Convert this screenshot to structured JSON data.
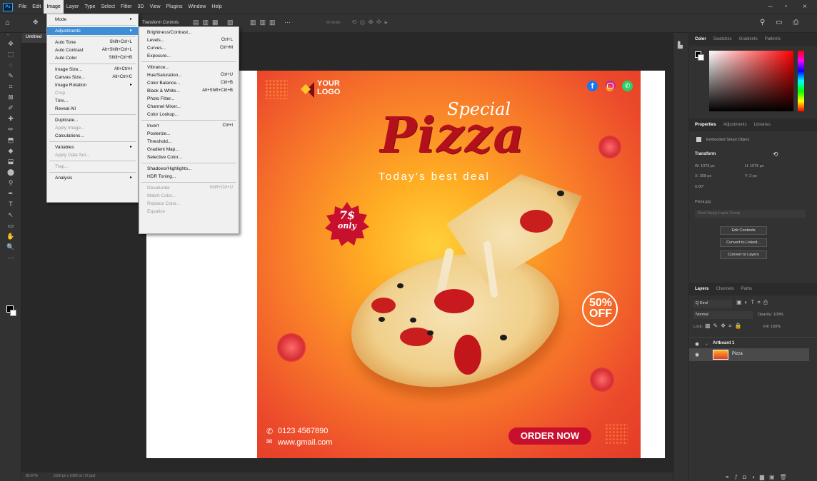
{
  "app": {
    "logo": "Ps",
    "menus": [
      "File",
      "Edit",
      "Image",
      "Layer",
      "Type",
      "Select",
      "Filter",
      "3D",
      "View",
      "Plugins",
      "Window",
      "Help"
    ],
    "active_menu": "Image"
  },
  "options": {
    "transform_controls": "Transform Controls",
    "mode_3d": "3D Mode:"
  },
  "document": {
    "tab": "Untitled",
    "status": "1920 px x 1080 px (72 ppi)",
    "zoom": "80.67%"
  },
  "image_menu": {
    "groups": [
      [
        {
          "label": "Mode",
          "sc": "",
          "sub": true,
          "dis": false
        }
      ],
      [
        {
          "label": "Adjustments",
          "sc": "",
          "sub": true,
          "dis": false,
          "hl": true
        }
      ],
      [
        {
          "label": "Auto Tone",
          "sc": "Shift+Ctrl+L"
        },
        {
          "label": "Auto Contrast",
          "sc": "Alt+Shift+Ctrl+L"
        },
        {
          "label": "Auto Color",
          "sc": "Shift+Ctrl+B"
        }
      ],
      [
        {
          "label": "Image Size...",
          "sc": "Alt+Ctrl+I"
        },
        {
          "label": "Canvas Size...",
          "sc": "Alt+Ctrl+C"
        },
        {
          "label": "Image Rotation",
          "sc": "",
          "sub": true
        },
        {
          "label": "Crop",
          "sc": "",
          "dis": true
        },
        {
          "label": "Trim...",
          "sc": ""
        },
        {
          "label": "Reveal All",
          "sc": ""
        }
      ],
      [
        {
          "label": "Duplicate...",
          "sc": ""
        },
        {
          "label": "Apply Image...",
          "sc": "",
          "dis": true
        },
        {
          "label": "Calculations...",
          "sc": ""
        }
      ],
      [
        {
          "label": "Variables",
          "sc": "",
          "sub": true
        },
        {
          "label": "Apply Data Set...",
          "sc": "",
          "dis": true
        }
      ],
      [
        {
          "label": "Trap...",
          "sc": "",
          "dis": true
        }
      ],
      [
        {
          "label": "Analysis",
          "sc": "",
          "sub": true
        }
      ]
    ]
  },
  "adjustments_menu": {
    "groups": [
      [
        {
          "label": "Brightness/Contrast...",
          "sc": ""
        },
        {
          "label": "Levels...",
          "sc": "Ctrl+L"
        },
        {
          "label": "Curves...",
          "sc": "Ctrl+M"
        },
        {
          "label": "Exposure...",
          "sc": ""
        }
      ],
      [
        {
          "label": "Vibrance...",
          "sc": ""
        },
        {
          "label": "Hue/Saturation...",
          "sc": "Ctrl+U"
        },
        {
          "label": "Color Balance...",
          "sc": "Ctrl+B"
        },
        {
          "label": "Black & White...",
          "sc": "Alt+Shift+Ctrl+B"
        },
        {
          "label": "Photo Filter...",
          "sc": ""
        },
        {
          "label": "Channel Mixer...",
          "sc": ""
        },
        {
          "label": "Color Lookup...",
          "sc": ""
        }
      ],
      [
        {
          "label": "Invert",
          "sc": "Ctrl+I"
        },
        {
          "label": "Posterize...",
          "sc": ""
        },
        {
          "label": "Threshold...",
          "sc": ""
        },
        {
          "label": "Gradient Map...",
          "sc": ""
        },
        {
          "label": "Selective Color...",
          "sc": ""
        }
      ],
      [
        {
          "label": "Shadows/Highlights...",
          "sc": ""
        },
        {
          "label": "HDR Toning...",
          "sc": ""
        }
      ],
      [
        {
          "label": "Desaturate",
          "sc": "Shift+Ctrl+U",
          "dis": true
        },
        {
          "label": "Match Color...",
          "sc": "",
          "dis": true
        },
        {
          "label": "Replace Color...",
          "sc": "",
          "dis": true
        },
        {
          "label": "Equalize",
          "sc": "",
          "dis": true
        }
      ]
    ]
  },
  "poster": {
    "logo_line1": "YOUR",
    "logo_line2": "LOGO",
    "special": "Special",
    "pizza": "Pizza",
    "tagline": "Today's best deal",
    "price": "7$",
    "price_sub": "only",
    "discount": "50%",
    "discount_sub": "OFF",
    "phone": "0123 4567890",
    "email": "www.gmail.com",
    "order": "ORDER NOW"
  },
  "color_panel": {
    "tabs": [
      "Color",
      "Swatches",
      "Gradients",
      "Patterns"
    ]
  },
  "properties": {
    "tabs": [
      "Properties",
      "Adjustments",
      "Libraries"
    ],
    "object_type": "Embedded Smart Object",
    "transform_title": "Transform",
    "w": "W: 1076 px",
    "h": "H: 1076 px",
    "x": "X: 308 px",
    "y": "Y: 2 px",
    "angle": "0.00°",
    "file": "Pizza.jpg",
    "comp": "Don't Apply Layer Comp",
    "btn_edit": "Edit Contents",
    "btn_linked": "Convert to Linked...",
    "btn_layers": "Convert to Layers"
  },
  "layers": {
    "tabs": [
      "Layers",
      "Channels",
      "Paths"
    ],
    "kind": "Q Kind",
    "blend": "Normal",
    "opacity": "Opacity: 100%",
    "lock": "Lock:",
    "fill": "Fill: 100%",
    "artboard": "Artboard 1",
    "layer": "Pizza"
  },
  "colors": {
    "accent": "#3e8ed8",
    "poster_red": "#c8102e",
    "ui_dark": "#323232"
  }
}
